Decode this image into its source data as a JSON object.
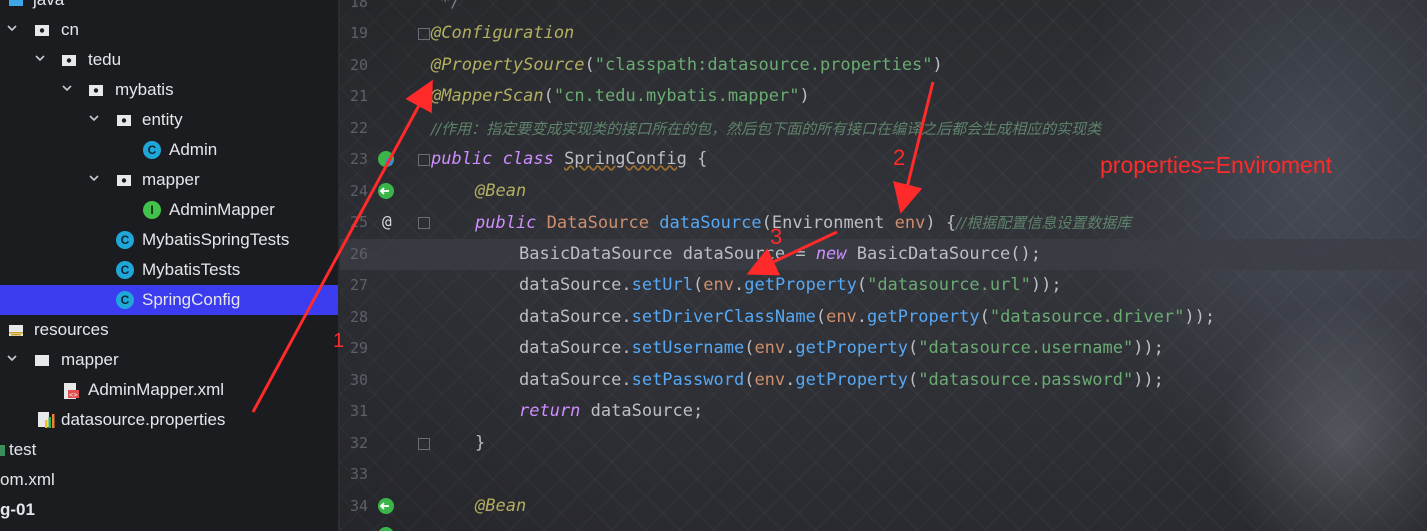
{
  "project_tree": {
    "items": [
      {
        "label": "java",
        "icon": "folder-icon"
      },
      {
        "label": "cn",
        "icon": "package-icon"
      },
      {
        "label": "tedu",
        "icon": "package-icon"
      },
      {
        "label": "mybatis",
        "icon": "package-icon"
      },
      {
        "label": "entity",
        "icon": "package-icon"
      },
      {
        "label": "Admin",
        "icon": "class-icon"
      },
      {
        "label": "mapper",
        "icon": "package-icon"
      },
      {
        "label": "AdminMapper",
        "icon": "interface-icon"
      },
      {
        "label": "MybatisSpringTests",
        "icon": "test-class-icon"
      },
      {
        "label": "MybatisTests",
        "icon": "test-class-icon"
      },
      {
        "label": "SpringConfig",
        "icon": "class-icon",
        "selected": true
      },
      {
        "label": "resources",
        "icon": "resources-folder-icon"
      },
      {
        "label": "mapper",
        "icon": "folder-icon"
      },
      {
        "label": "AdminMapper.xml",
        "icon": "xml-file-icon"
      },
      {
        "label": "datasource.properties",
        "icon": "properties-file-icon"
      },
      {
        "label": "test",
        "icon": "folder-icon"
      },
      {
        "label": "om.xml",
        "icon": "xml-file-icon"
      },
      {
        "label": "g-01",
        "icon": "module-icon"
      }
    ]
  },
  "editor": {
    "line_numbers": [
      "18",
      "19",
      "20",
      "21",
      "22",
      "23",
      "24",
      "25",
      "26",
      "27",
      "28",
      "29",
      "30",
      "31",
      "32",
      "33",
      "34"
    ],
    "lines": {
      "l18": "*/",
      "l19_ann": "@Configuration",
      "l20_ann": "@PropertySource",
      "l20_p1": "(",
      "l20_str": "\"classpath:datasource.properties\"",
      "l20_p2": ")",
      "l21_ann": "@MapperScan",
      "l21_p1": "(",
      "l21_str": "\"cn.tedu.mybatis.mapper\"",
      "l21_p2": ")",
      "l22_cmt": "//作用：指定要变成实现类的接口所在的包，然后包下面的所有接口在编译之后都会生成相应的实现类",
      "l23_kw": "public class ",
      "l23_cls": "SpringConfig",
      "l23_rest": " {",
      "l24_ann": "@Bean",
      "l25_kw": "public ",
      "l25_type": "DataSource ",
      "l25_mth": "dataSource",
      "l25_p1": "(Environment ",
      "l25_param": "env",
      "l25_p2": ") {",
      "l25_cmt": "//根据配置信息设置数据库",
      "l26_a": "BasicDataSource dataSource = ",
      "l26_new": "new ",
      "l26_b": "BasicDataSource();",
      "l27_a": "dataSource.",
      "l27_mth": "setUrl",
      "l27_p1": "(",
      "l27_env": "env",
      "l27_dot": ".",
      "l27_get": "getProperty",
      "l27_p2": "(",
      "l27_str": "\"datasource.url\"",
      "l27_p3": "));",
      "l28_a": "dataSource.",
      "l28_mth": "setDriverClassName",
      "l28_p1": "(",
      "l28_env": "env",
      "l28_dot": ".",
      "l28_get": "getProperty",
      "l28_p2": "(",
      "l28_str": "\"datasource.driver\"",
      "l28_p3": "));",
      "l29_a": "dataSource.",
      "l29_mth": "setUsername",
      "l29_p1": "(",
      "l29_env": "env",
      "l29_dot": ".",
      "l29_get": "getProperty",
      "l29_p2": "(",
      "l29_str": "\"datasource.username\"",
      "l29_p3": "));",
      "l30_a": "dataSource.",
      "l30_mth": "setPassword",
      "l30_p1": "(",
      "l30_env": "env",
      "l30_dot": ".",
      "l30_get": "getProperty",
      "l30_p2": "(",
      "l30_str": "\"datasource.password\"",
      "l30_p3": "));",
      "l31_kw": "return ",
      "l31_rest": "dataSource;",
      "l32": "}",
      "l34_ann": "@Bean"
    }
  },
  "annotations": {
    "marker_1": "1",
    "marker_2": "2",
    "marker_3": "3",
    "note": "properties=Enviroment",
    "color": "#ff2a2a"
  },
  "colors": {
    "sidebar_bg": "#1b1c1f",
    "selection": "#3b3bf0",
    "keyword": "#cf8e6d",
    "annotation": "#b3ae60",
    "string": "#6aab73",
    "method": "#56a8f5",
    "comment": "#5f826b"
  }
}
